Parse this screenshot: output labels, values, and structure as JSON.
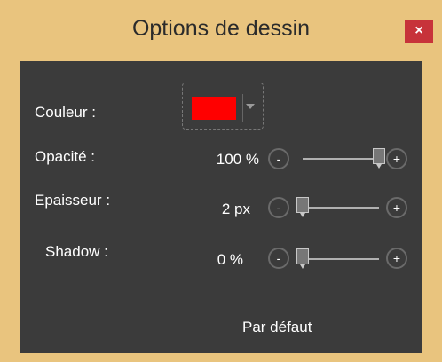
{
  "window": {
    "title": "Options de dessin",
    "close_label": "×"
  },
  "colors": {
    "title_bar": "#e9c47e",
    "panel": "#3b3b3b",
    "close": "#c7333a",
    "swatch": "#ff0000"
  },
  "fields": {
    "color": {
      "label": "Couleur :",
      "value": "#ff0000"
    },
    "opacity": {
      "label": "Opacité :",
      "value_text": "100 %",
      "level": 1.0
    },
    "thickness": {
      "label": "Epaisseur :",
      "value_text": "2 px",
      "level": 0.0
    },
    "shadow": {
      "label": "Shadow :",
      "value_text": "0 %",
      "level": 0.0
    }
  },
  "buttons": {
    "minus": "-",
    "plus": "+",
    "default_label": "Par défaut"
  }
}
